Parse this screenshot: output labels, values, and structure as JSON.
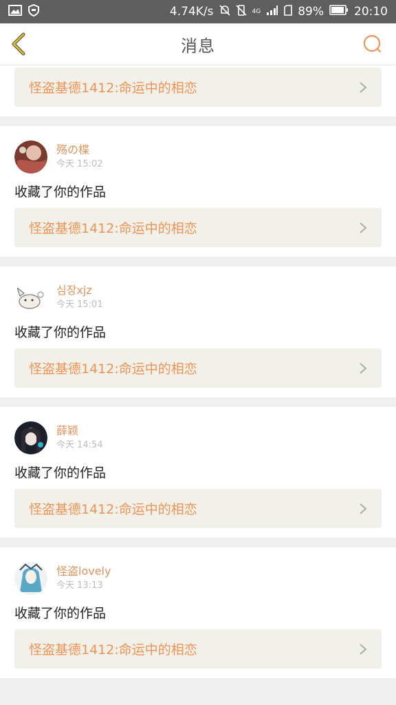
{
  "status_bar": {
    "speed": "4.74K/s",
    "network": "4G",
    "battery": "89%",
    "time": "20:10"
  },
  "nav": {
    "title": "消息",
    "back_icon": "chevron-left-icon",
    "search_icon": "search-icon"
  },
  "colors": {
    "accent": "#ee9256",
    "username": "#e2935b",
    "back_arrow": "#e3c31d",
    "link_bg": "#f1f1e9"
  },
  "top_partial_card": {
    "work_title": "怪盗基德1412:命运中的相恋"
  },
  "notifications": [
    {
      "username": "殇の楪",
      "time": "今天 15:02",
      "action": "收藏了你的作品",
      "work_title": "怪盗基德1412:命运中的相恋"
    },
    {
      "username": "심장xjz",
      "time": "今天 15:01",
      "action": "收藏了你的作品",
      "work_title": "怪盗基德1412:命运中的相恋"
    },
    {
      "username": "薛颖",
      "time": "今天 14:54",
      "action": "收藏了你的作品",
      "work_title": "怪盗基德1412:命运中的相恋"
    },
    {
      "username": "怪盗lovely",
      "time": "今天 13:13",
      "action": "收藏了你的作品",
      "work_title": "怪盗基德1412:命运中的相恋"
    }
  ]
}
